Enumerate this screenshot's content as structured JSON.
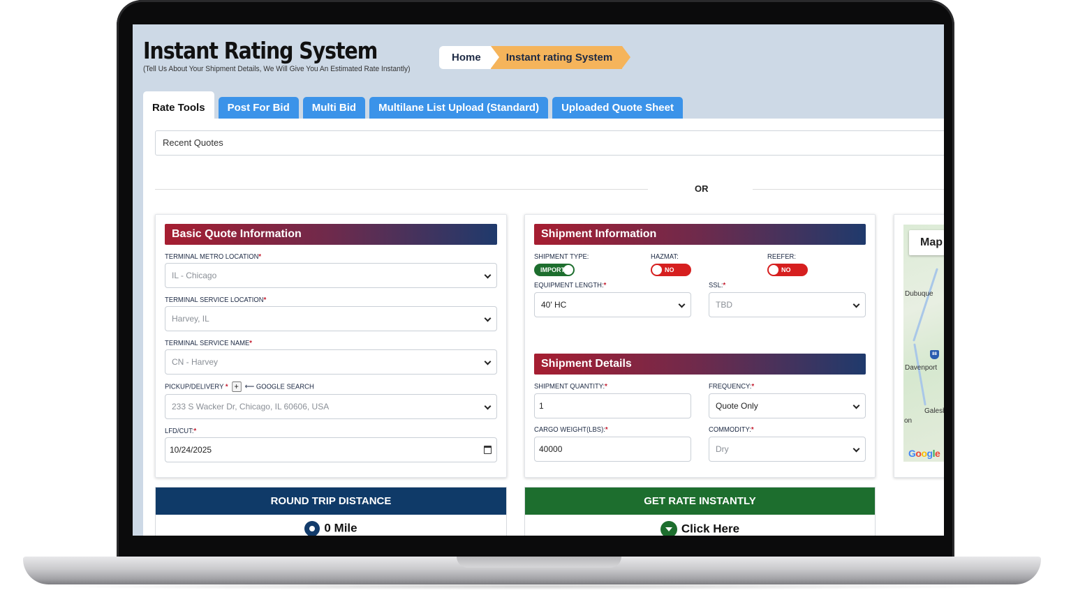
{
  "header": {
    "title": "Instant Rating System",
    "subtitle": "(Tell Us About Your Shipment Details, We Will Give You An Estimated Rate Instantly)"
  },
  "breadcrumb": {
    "home": "Home",
    "current": "Instant rating System"
  },
  "tabs": [
    {
      "label": "Rate Tools",
      "active": true
    },
    {
      "label": "Post For Bid",
      "active": false
    },
    {
      "label": "Multi Bid",
      "active": false
    },
    {
      "label": "Multilane List Upload (Standard)",
      "active": false
    },
    {
      "label": "Uploaded Quote Sheet",
      "active": false
    }
  ],
  "recent_quotes": {
    "value": "Recent Quotes"
  },
  "divider": {
    "text": "OR"
  },
  "basic_quote": {
    "title": "Basic Quote Information",
    "terminal_metro_label": "TERMINAL METRO LOCATION",
    "terminal_metro_value": "IL - Chicago",
    "terminal_service_location_label": "TERMINAL SERVICE LOCATION",
    "terminal_service_location_value": "Harvey, IL",
    "terminal_service_name_label": "TERMINAL SERVICE NAME",
    "terminal_service_name_value": "CN - Harvey",
    "pickup_label": "PICKUP/DELIVERY",
    "plus": "+",
    "google_search_label": "⟵ GOOGLE SEARCH",
    "pickup_value": "233 S Wacker Dr, Chicago, IL 60606, USA",
    "lfd_label": "LFD/CUT:",
    "lfd_value": "10/24/2025",
    "required_mark": "*"
  },
  "shipment_info": {
    "title": "Shipment Information",
    "shipment_type_label": "SHIPMENT TYPE:",
    "shipment_type_value": "IMPORT",
    "hazmat_label": "HAZMAT:",
    "hazmat_value": "NO",
    "reefer_label": "REEFER:",
    "reefer_value": "NO",
    "equipment_length_label": "EQUIPMENT LENGTH:",
    "equipment_length_value": "40' HC",
    "ssl_label": "SSL:",
    "ssl_value": "TBD"
  },
  "shipment_details": {
    "title": "Shipment Details",
    "quantity_label": "SHIPMENT QUANTITY:",
    "quantity_value": "1",
    "frequency_label": "FREQUENCY:",
    "frequency_value": "Quote Only",
    "cargo_weight_label": "CARGO WEIGHT(LBS):",
    "cargo_weight_value": "40000",
    "commodity_label": "COMMODITY:",
    "commodity_value": "Dry"
  },
  "map": {
    "button": "Map",
    "labels": [
      "Dubuque",
      "Davenport",
      "Galesbu",
      "on"
    ],
    "highway": "88",
    "google": "Google"
  },
  "round_trip": {
    "title": "ROUND TRIP DISTANCE",
    "value": "0 Mile"
  },
  "get_rate": {
    "title": "GET RATE INSTANTLY",
    "value": "Click Here"
  },
  "colors": {
    "tab_blue": "#3b93e9",
    "breadcrumb_orange": "#f5b45b",
    "header_gradient_start": "#a61e31",
    "header_gradient_end": "#1f3a6c",
    "round_trip_navy": "#0f3a68",
    "get_rate_green": "#1d6e2e",
    "toggle_red": "#d61f1f"
  }
}
